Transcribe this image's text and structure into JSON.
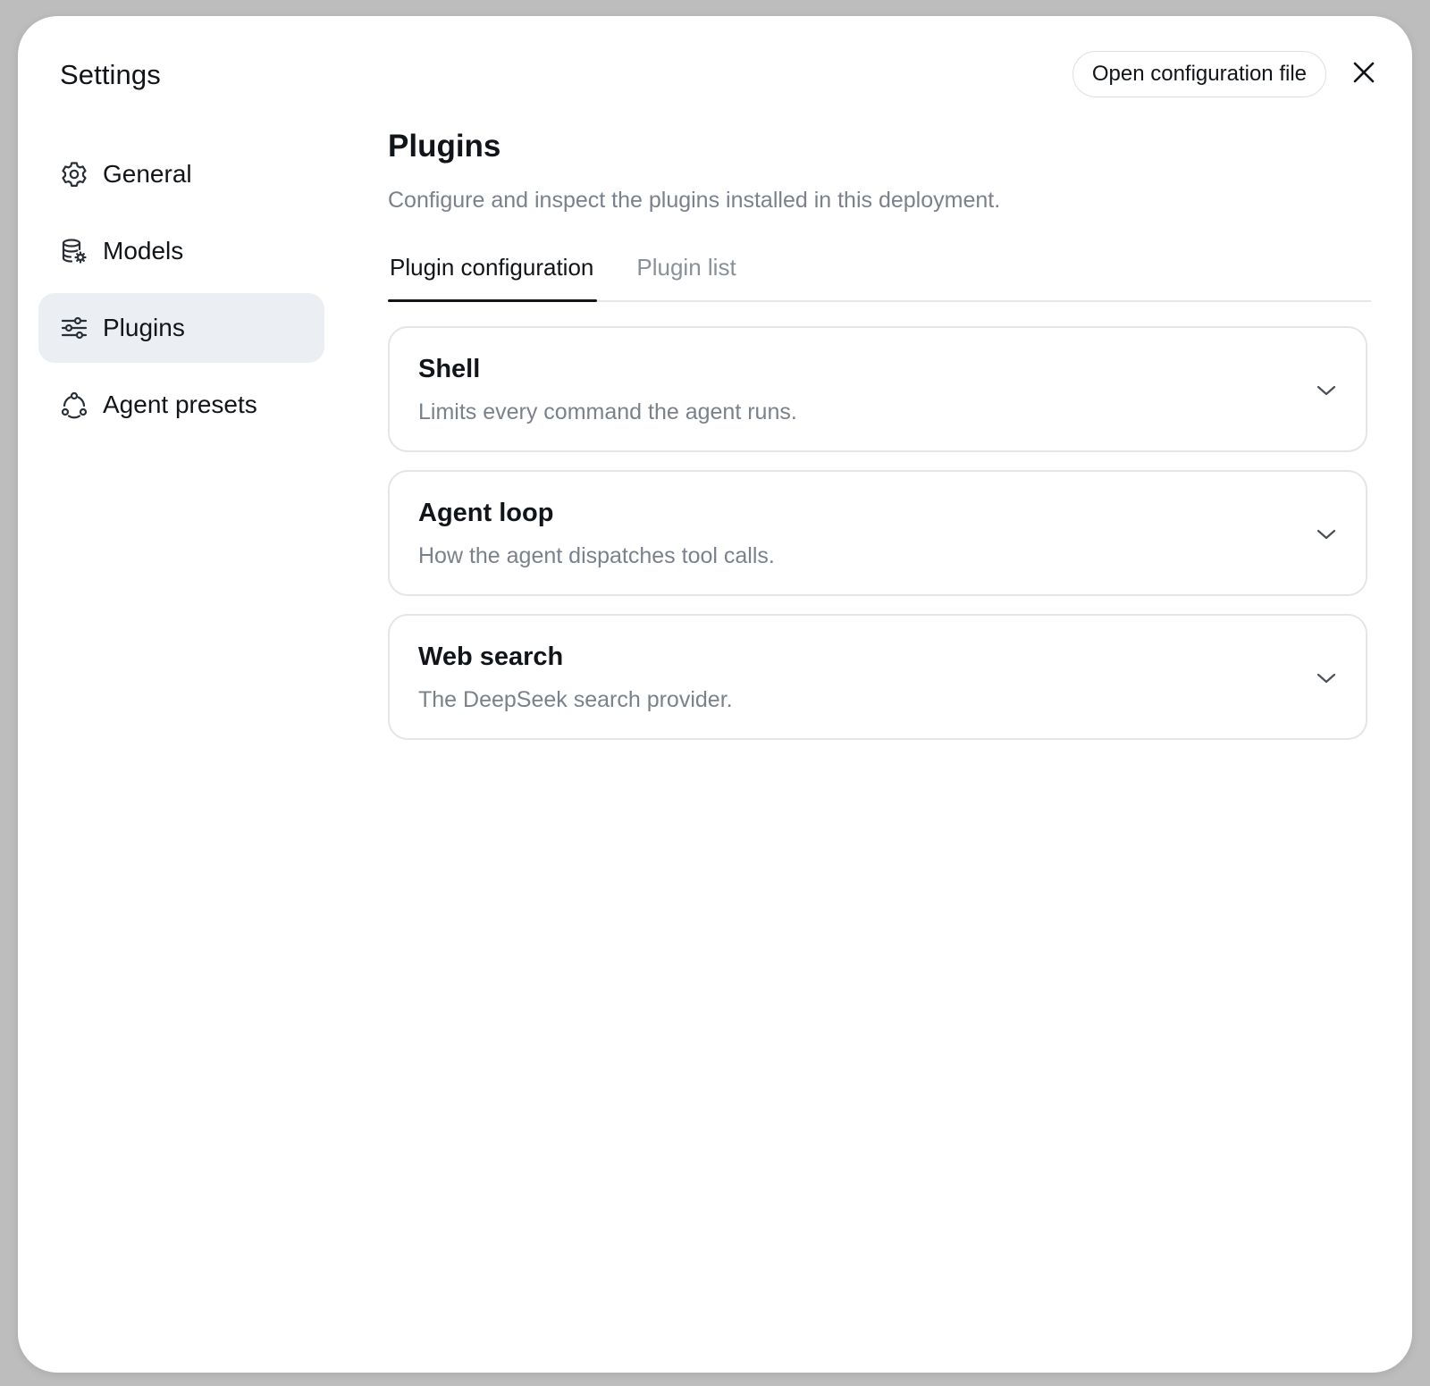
{
  "sidebar": {
    "title": "Settings",
    "items": [
      {
        "label": "General",
        "icon": "gear-icon",
        "active": false
      },
      {
        "label": "Models",
        "icon": "database-gear-icon",
        "active": false
      },
      {
        "label": "Plugins",
        "icon": "sliders-icon",
        "active": true
      },
      {
        "label": "Agent presets",
        "icon": "agent-cycle-icon",
        "active": false
      }
    ]
  },
  "header": {
    "open_config_label": "Open configuration file",
    "close_icon": "close-icon"
  },
  "main": {
    "title": "Plugins",
    "subtitle": "Configure and inspect the plugins installed in this deployment.",
    "tabs": [
      {
        "label": "Plugin configuration",
        "active": true
      },
      {
        "label": "Plugin list",
        "active": false
      }
    ],
    "plugins": [
      {
        "title": "Shell",
        "description": "Limits every command the agent runs."
      },
      {
        "title": "Agent loop",
        "description": "How the agent dispatches tool calls."
      },
      {
        "title": "Web search",
        "description": "The DeepSeek search provider."
      }
    ]
  },
  "colors": {
    "backdrop": "#bdbdbd",
    "active_nav_bg": "#ebeef2",
    "muted_text": "#7b818b",
    "border": "#e3e5e9",
    "text": "#111418"
  }
}
